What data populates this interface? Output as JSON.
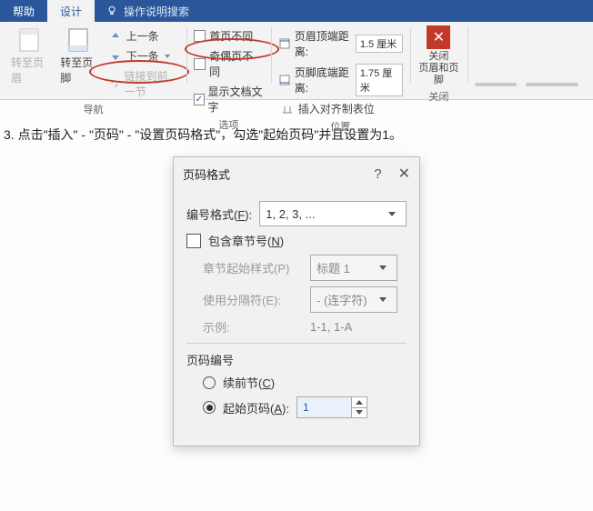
{
  "ribbon": {
    "tabs": {
      "help": "帮助",
      "design": "设计"
    },
    "tell_me": "操作说明搜索",
    "nav_group": {
      "goto_header": "转至页眉",
      "goto_footer": "转至页脚",
      "prev": "上一条",
      "next": "下一条",
      "link_prev": "链接到前一节",
      "label": "导航"
    },
    "options_group": {
      "first_diff": "首页不同",
      "odd_even_diff": "奇偶页不同",
      "show_doc_text": "显示文档文字",
      "label": "选项"
    },
    "position_group": {
      "header_top": "页眉顶端距离:",
      "header_top_val": "1.5 厘米",
      "footer_bottom": "页脚底端距离:",
      "footer_bottom_val": "1.75 厘米",
      "insert_align_tab": "插入对齐制表位",
      "label": "位置"
    },
    "close_group": {
      "close": "关闭",
      "close_sub": "页眉和页脚",
      "label": "关闭"
    }
  },
  "instruction": "3. 点击\"插入\" - \"页码\" - \"设置页码格式\"，勾选\"起始页码\"并且设置为1。",
  "dialog": {
    "title": "页码格式",
    "number_format": {
      "label_pre": "编号格式(",
      "hot": "F",
      "label_post": "):",
      "value": "1, 2, 3, ..."
    },
    "include_chapter": {
      "label_pre": "包含章节号(",
      "hot": "N",
      "label_post": ")"
    },
    "chapter_style": {
      "label": "章节起始样式(P)",
      "value": "标题 1"
    },
    "separator": {
      "label": "使用分隔符(E):",
      "value": "- (连字符)"
    },
    "example": {
      "label": "示例:",
      "value": "1-1, 1-A"
    },
    "page_numbering": "页码编号",
    "continue": {
      "label_pre": "续前节(",
      "hot": "C",
      "label_post": ")"
    },
    "start_at": {
      "label_pre": "起始页码(",
      "hot": "A",
      "label_post": "):",
      "value": "1"
    }
  }
}
